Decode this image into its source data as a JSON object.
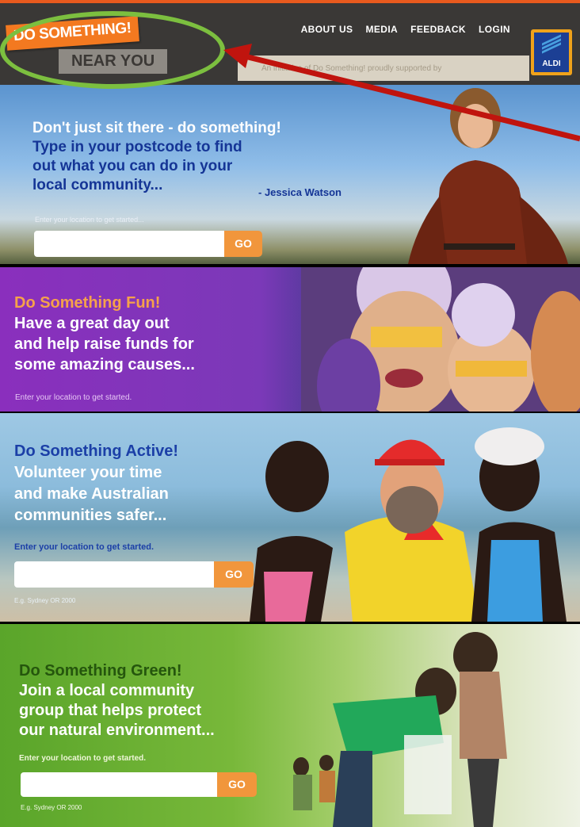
{
  "header": {
    "nav": [
      "ABOUT US",
      "MEDIA",
      "FEEDBACK",
      "LOGIN"
    ],
    "logo_top": "DO SOMETHING!",
    "logo_bottom": "NEAR YOU",
    "tagline": "An initiative of Do Something! proudly supported by",
    "sponsor": "ALDI"
  },
  "banner1": {
    "headline": "Don't just sit there - do something!",
    "body_lines": [
      "Type in your postcode to find",
      "out what you can do in your",
      "local community..."
    ],
    "attribution": "- Jessica Watson",
    "prompt": "Enter your location to get started...",
    "go": "GO"
  },
  "banner2": {
    "headline": "Do Something Fun!",
    "body_lines": [
      "Have a great day out",
      "and help raise funds for",
      "some amazing causes..."
    ],
    "prompt": "Enter your location to get started."
  },
  "banner3": {
    "headline": "Do Something Active!",
    "body_lines": [
      "Volunteer your time",
      "and make Australian",
      "communities safer..."
    ],
    "prompt": "Enter your location to get started.",
    "go": "GO",
    "hint": "E.g. Sydney OR 2000"
  },
  "banner4": {
    "headline": "Do Something Green!",
    "body_lines": [
      "Join a local community",
      "group that helps protect",
      "our natural environment..."
    ],
    "prompt": "Enter your location to get started.",
    "go": "GO",
    "hint": "E.g. Sydney OR 2000"
  },
  "colors": {
    "accent": "#f37920",
    "ring": "#7cbf3f",
    "arrow": "#c0140e"
  }
}
